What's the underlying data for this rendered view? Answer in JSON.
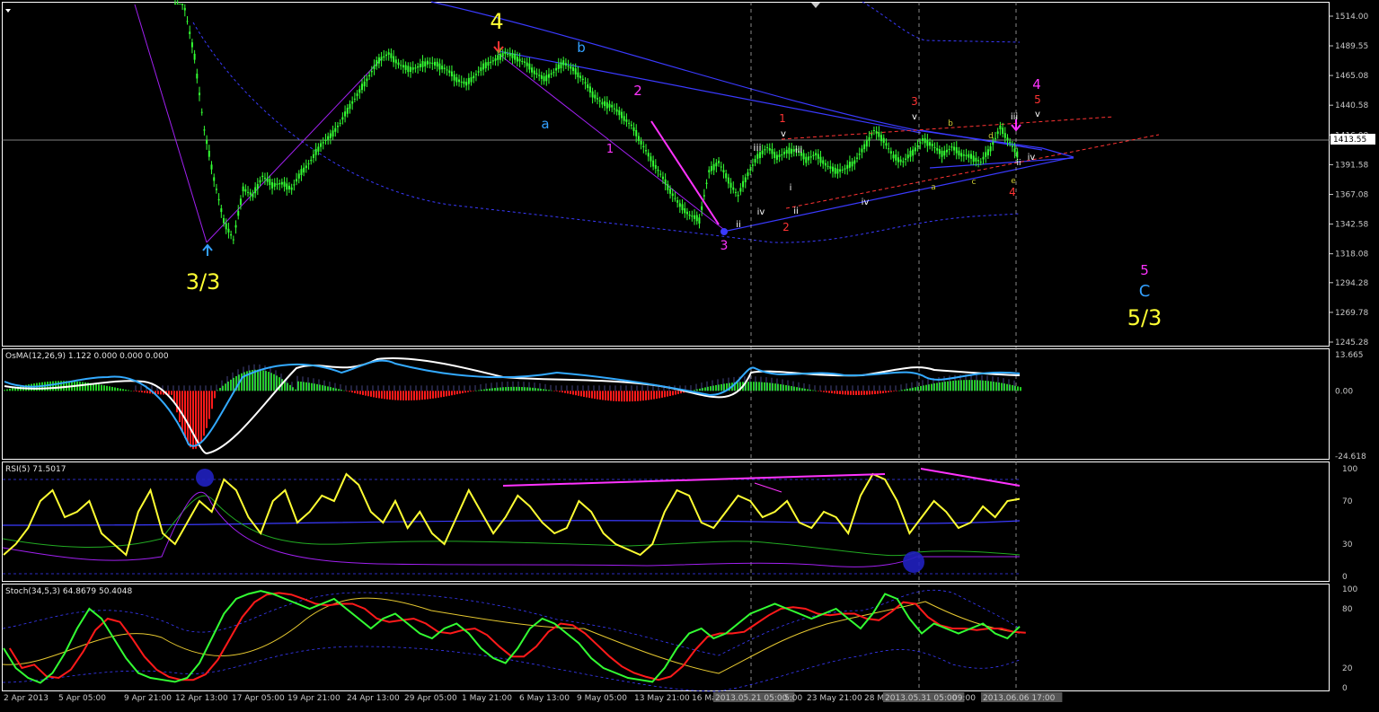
{
  "colors": {
    "background": "#000000",
    "frame": "#ffffff",
    "candle": "#33ff33",
    "ma_line": "#3a3aff",
    "bands": "#3a3aff",
    "osma_pos": "#22cc22",
    "osma_neg": "#ff1a1a",
    "osma_signal": "#ffffff",
    "osma_macd": "#33aaff",
    "rsi": "#ffff33",
    "rsi_channel": "#ff33ff",
    "stoch_main": "#33ff33",
    "stoch_signal": "#ff1a1a",
    "price_badge_bg": "#ffffff"
  },
  "chart_data": [
    {
      "type": "line",
      "name": "price-panel",
      "current_price_label": "1413.55",
      "y_ticks": [
        "1514.00",
        "1489.55",
        "1465.08",
        "1440.58",
        "1416.08",
        "1391.58",
        "1367.08",
        "1342.58",
        "1318.08",
        "1294.28",
        "1269.78",
        "1245.28"
      ],
      "ylim": [
        1245.28,
        1514.0
      ],
      "x_ticks": [
        "2 Apr 2013",
        "5 Apr 05:00",
        "9 Apr 21:00",
        "12 Apr 13:00",
        "17 Apr 05:00",
        "19 Apr 21:00",
        "24 Apr 13:00",
        "29 Apr 05:00",
        "1 May 21:00",
        "6 May 13:00",
        "9 May 05:00",
        "13 May 21:00",
        "16 Ma",
        "2013.05.21 05:00",
        "5:00",
        "23 May 21:00",
        "28 M",
        "2013.05.31 05:00",
        "09:00",
        "2013.06.06 17:00"
      ],
      "price_series": [
        1540,
        1520,
        1480,
        1420,
        1380,
        1345,
        1330,
        1372,
        1366,
        1382,
        1375,
        1376,
        1372,
        1385,
        1395,
        1408,
        1415,
        1426,
        1440,
        1452,
        1465,
        1478,
        1483,
        1475,
        1470,
        1472,
        1476,
        1474,
        1470,
        1462,
        1458,
        1466,
        1474,
        1478,
        1484,
        1480,
        1476,
        1468,
        1462,
        1468,
        1476,
        1470,
        1462,
        1450,
        1442,
        1440,
        1432,
        1424,
        1410,
        1396,
        1384,
        1370,
        1358,
        1350,
        1346,
        1386,
        1394,
        1378,
        1366,
        1384,
        1398,
        1406,
        1398,
        1402,
        1404,
        1396,
        1400,
        1392,
        1386,
        1388,
        1394,
        1406,
        1420,
        1412,
        1398,
        1394,
        1402,
        1412,
        1408,
        1400,
        1406,
        1400,
        1398,
        1394,
        1405,
        1422,
        1410,
        1396
      ],
      "annotations": [
        {
          "text": "3/3",
          "color": "#ffff33"
        },
        {
          "text": "4",
          "color": "#ffff33"
        },
        {
          "text": "b",
          "color": "#33a0ff"
        },
        {
          "text": "a",
          "color": "#33a0ff"
        },
        {
          "text": "2",
          "color": "#ff33ff"
        },
        {
          "text": "1",
          "color": "#ff33ff"
        },
        {
          "text": "3",
          "color": "#ff33ff"
        },
        {
          "text": "1",
          "color": "#ff3333"
        },
        {
          "text": "2",
          "color": "#ff3333"
        },
        {
          "text": "3",
          "color": "#ff3333"
        },
        {
          "text": "4",
          "color": "#ff3333"
        },
        {
          "text": "5",
          "color": "#ff3333"
        },
        {
          "text": "4",
          "color": "#ff33ff"
        },
        {
          "text": "iii",
          "color": "#ffffff"
        },
        {
          "text": "iv",
          "color": "#ffffff"
        },
        {
          "text": "ii",
          "color": "#ffffff"
        },
        {
          "text": "v",
          "color": "#ffffff"
        },
        {
          "text": "iii",
          "color": "#ffffff"
        },
        {
          "text": "i",
          "color": "#ffffff"
        },
        {
          "text": "ii",
          "color": "#ffffff"
        },
        {
          "text": "iv",
          "color": "#ffffff"
        },
        {
          "text": "v",
          "color": "#ffffff"
        },
        {
          "text": "iii",
          "color": "#ffffff"
        },
        {
          "text": "iv",
          "color": "#ffffff"
        },
        {
          "text": "v",
          "color": "#ffffff"
        },
        {
          "text": "a",
          "color": "#cccc33"
        },
        {
          "text": "b",
          "color": "#cccc33"
        },
        {
          "text": "c",
          "color": "#cccc33"
        },
        {
          "text": "d",
          "color": "#cccc33"
        },
        {
          "text": "e",
          "color": "#cccc33"
        },
        {
          "text": "ii",
          "color": "#ffffff"
        },
        {
          "text": "5",
          "color": "#ff33ff"
        },
        {
          "text": "C",
          "color": "#33a0ff"
        },
        {
          "text": "5/3",
          "color": "#ffff33"
        }
      ]
    },
    {
      "type": "bar",
      "name": "osma-panel",
      "title": "OsMA(12,26,9) 1.122 0.000 0.000 0.000",
      "y_ticks": [
        "13.665",
        "0.00",
        "-24.618"
      ],
      "ylim": [
        -24.618,
        13.665
      ]
    },
    {
      "type": "line",
      "name": "rsi-panel",
      "title": "RSI(5) 71.5017",
      "y_ticks": [
        "100",
        "70",
        "30",
        "0"
      ],
      "ylim": [
        0,
        100
      ],
      "values": [
        20,
        30,
        45,
        70,
        80,
        55,
        60,
        70,
        40,
        30,
        20,
        60,
        80,
        40,
        30,
        50,
        70,
        60,
        90,
        80,
        55,
        40,
        70,
        80,
        50,
        60,
        75,
        70,
        95,
        85,
        60,
        50,
        70,
        45,
        60,
        40,
        30,
        55,
        80,
        60,
        40,
        55,
        75,
        65,
        50,
        40,
        45,
        70,
        60,
        40,
        30,
        25,
        20,
        30,
        60,
        80,
        75,
        50,
        45,
        60,
        75,
        70,
        55,
        60,
        70,
        50,
        45,
        60,
        55,
        40,
        75,
        95,
        90,
        70,
        40,
        55,
        70,
        60,
        45,
        50,
        65,
        55,
        70,
        72
      ]
    },
    {
      "type": "line",
      "name": "stoch-panel",
      "title": "Stoch(34,5,3) 64.8679 50.4048",
      "y_ticks": [
        "100",
        "80",
        "20",
        "0"
      ],
      "ylim": [
        0,
        100
      ],
      "main": [
        40,
        20,
        10,
        5,
        15,
        35,
        60,
        80,
        70,
        50,
        30,
        15,
        10,
        8,
        6,
        10,
        25,
        50,
        75,
        90,
        95,
        98,
        95,
        90,
        85,
        80,
        85,
        90,
        80,
        70,
        60,
        70,
        75,
        65,
        55,
        50,
        60,
        65,
        55,
        40,
        30,
        25,
        40,
        60,
        70,
        65,
        55,
        45,
        30,
        20,
        15,
        10,
        8,
        6,
        20,
        40,
        55,
        60,
        50,
        55,
        65,
        75,
        80,
        85,
        80,
        75,
        70,
        75,
        80,
        70,
        60,
        75,
        95,
        90,
        70,
        55,
        65,
        60,
        55,
        60,
        65,
        55,
        50,
        62
      ]
    }
  ]
}
